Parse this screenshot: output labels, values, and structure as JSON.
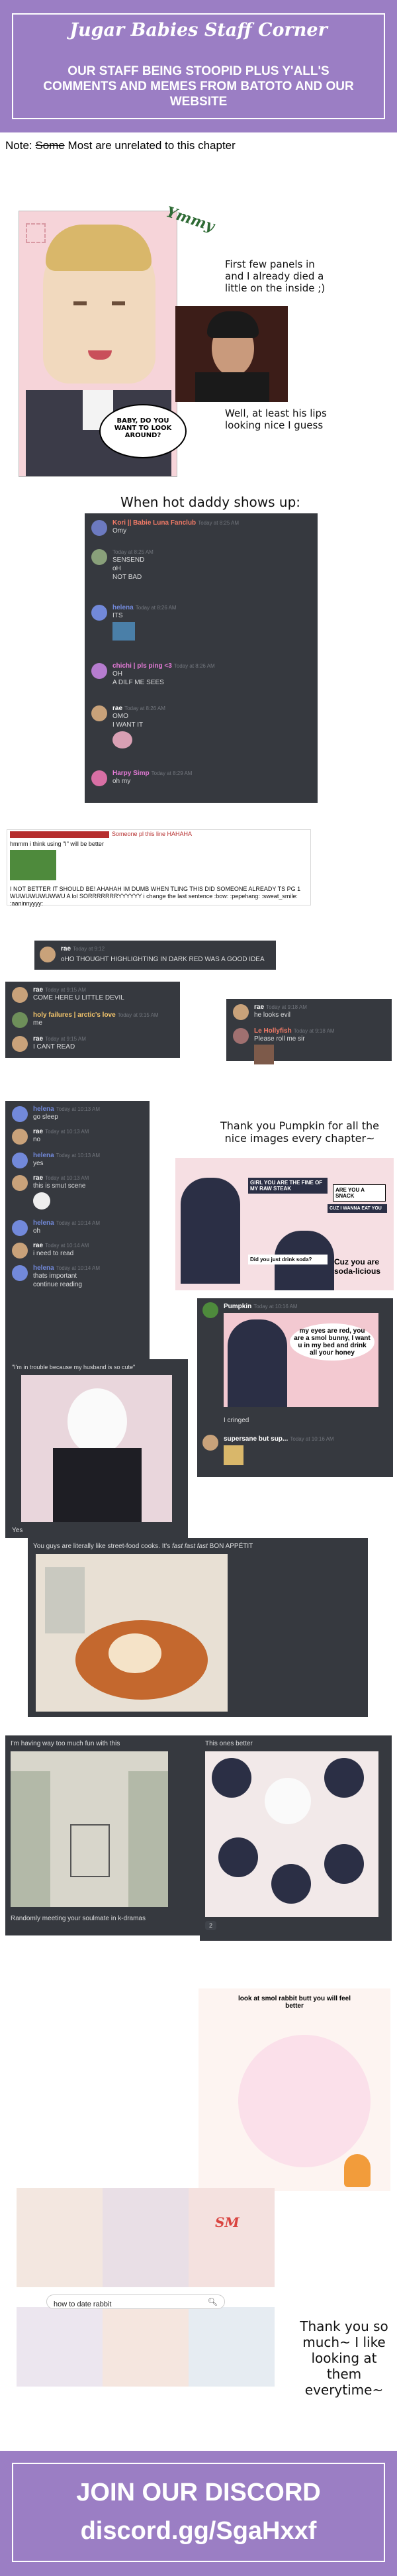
{
  "header": {
    "title": "Jugar Babies Staff Corner",
    "subtitle": "OUR STAFF BEING STOOPID PLUS Y'ALL'S COMMENTS AND MEMES FROM BATOTO AND OUR WEBSITE"
  },
  "note": {
    "prefix": "Note:",
    "struck": "Some",
    "rest": "Most are unrelated to this chapter"
  },
  "panel1": {
    "stamp": "Ymmy",
    "caption_top": "First few panels in and I already died a little on the inside ;)",
    "bubble": "BABY, DO YOU WANT TO LOOK AROUND?",
    "caption_bottom": "Well, at least his lips looking nice I guess"
  },
  "hot_daddy": {
    "heading": "When hot daddy shows up:",
    "messages": [
      {
        "user": "Kori || Babie Luna Fanclub",
        "time": "Today at 8:25 AM",
        "lines": [
          "Omy"
        ],
        "color": "#f47b67"
      },
      {
        "user": "",
        "time": "Today at 8:25 AM",
        "lines": [
          "SENSEND",
          "oH",
          "NOT BAD"
        ],
        "color": "#b9bbbe"
      },
      {
        "user": "helena",
        "time": "Today at 8:26 AM",
        "lines": [
          "ITS"
        ],
        "color": "#7289da"
      },
      {
        "user": "chichi | pls ping <3",
        "time": "Today at 8:26 AM",
        "lines": [
          "OH",
          "A DILF ME SEES"
        ],
        "color": "#e67bd8"
      },
      {
        "user": "rae",
        "time": "Today at 8:26 AM",
        "lines": [
          "OMO",
          "I WANT IT"
        ],
        "color": "#ffffff"
      },
      {
        "user": "Harpy Simp",
        "time": "Today at 8:29 AM",
        "lines": [
          "oh my"
        ],
        "color": "#e67bd8"
      }
    ]
  },
  "comment": {
    "top": "Someone pl this line HAHAHA",
    "line1": "hmmm i think using \"I\" will be better",
    "body": "I NOT BETTER IT SHOULD BE! AHAHAH IM DUMB WHEN TLING THIS DID SOMEONE ALREADY TS PG 1 WUWUWUWUWWU A lol SORRRRRRRYYYYYY i change the last sentence :bow: :pepehang: :sweat_smile: :aaninnyyyy:"
  },
  "rae_chat": {
    "user": "rae",
    "time": "Today at 9:12",
    "text": "oHO THOUGHT HIGHLIGHTING IN DARK RED WAS A GOOD IDEA"
  },
  "devil_chat": {
    "messages": [
      {
        "user": "rae",
        "time": "Today at 9:15 AM",
        "text": "COME HERE U LITTLE DEVIL"
      },
      {
        "user": "holy failures | arctic's love",
        "time": "Today at 9:15 AM",
        "text": "me"
      },
      {
        "user": "rae",
        "time": "Today at 9:15 AM",
        "text": "I CANT READ"
      }
    ]
  },
  "lolly_chat": {
    "messages": [
      {
        "user": "rae",
        "time": "Today at 9:18 AM",
        "text": "he looks evil"
      },
      {
        "user": "Le Hollyfish",
        "time": "Today at 9:18 AM",
        "text": "Please roll me sir"
      }
    ]
  },
  "helena_chat": {
    "messages": [
      {
        "user": "helena",
        "time": "Today at 10:13 AM",
        "text": "go sleep"
      },
      {
        "user": "rae",
        "time": "Today at 10:13 AM",
        "text": "no"
      },
      {
        "user": "helena",
        "time": "Today at 10:13 AM",
        "text": "yes"
      },
      {
        "user": "rae",
        "time": "Today at 10:13 AM",
        "text": "this is smut scene"
      },
      {
        "user": "helena",
        "time": "Today at 10:14 AM",
        "text": "oh"
      },
      {
        "user": "rae",
        "time": "Today at 10:14 AM",
        "text": "i need to read"
      },
      {
        "user": "helena",
        "time": "Today at 10:14 AM",
        "text": "thats important",
        "text2": "continue reading"
      }
    ]
  },
  "thanks_pumpkin": {
    "caption": "Thank you Pumpkin for all the nice images every chapter~",
    "meme_lines": [
      "GIRL YOU ARE THE FINE OF MY RAW STEAK",
      "ARE YOU A SNACK",
      "CUZ I WANNA EAT YOU",
      "Did you just drink soda?",
      "Cuz you are soda-licious"
    ]
  },
  "pumpkin_chat": {
    "user": "Pumpkin",
    "time": "Today at 10:16 AM",
    "meme": "my eyes are red, you are a smol bunny, I want u in my bed and drink all your honey",
    "reply": "I cringed",
    "user2": "supersane but sup...",
    "time2": "Today at 10:16 AM"
  },
  "husband": {
    "caption": "\"I'm in trouble because my husband is so cute\"",
    "label": "Yes"
  },
  "street_food": {
    "caption_a": "You guys are literally like street-food cooks. It's ",
    "caption_em": "fast fast fast",
    "caption_b": " BON APPÉTIT"
  },
  "fun": {
    "caption": "I'm having way too much fun with this",
    "footer": "Randomly meeting your soulmate in k-dramas",
    "reaction": "2"
  },
  "better": {
    "caption": "This ones better",
    "reaction": "2"
  },
  "rabbit": {
    "caption": "look at smol rabbit butt you will feel better"
  },
  "search": {
    "value": "how to date rabbit"
  },
  "thanks_final": {
    "text": "Thank you so much~ I like looking at them everytime~",
    "sign": "SM"
  },
  "footer": {
    "line1": "JOIN OUR DISCORD",
    "line2": "discord.gg/SgaHxxf"
  }
}
